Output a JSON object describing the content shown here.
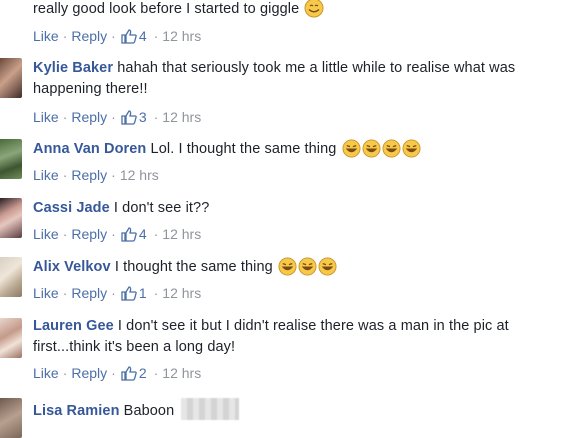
{
  "actions": {
    "like": "Like",
    "reply": "Reply",
    "separator": "·"
  },
  "comments": [
    {
      "name": "",
      "text": "really good look before I started to giggle",
      "emoji": "smile-emoji",
      "likes": "4",
      "time": "12 hrs"
    },
    {
      "name": "Kylie Baker",
      "text": "hahah that seriously took me a little while to realise what was happening there!!",
      "likes": "3",
      "time": "12 hrs"
    },
    {
      "name": "Anna Van Doren",
      "text": "Lol. I thought the same thing",
      "emoji": "laughing-emoji x4",
      "likes": "",
      "time": "12 hrs"
    },
    {
      "name": "Cassi Jade",
      "text": "I don't see it??",
      "likes": "4",
      "time": "12 hrs"
    },
    {
      "name": "Alix Velkov",
      "text": "I thought the same thing",
      "emoji": "laughing-emoji x3",
      "likes": "1",
      "time": "12 hrs"
    },
    {
      "name": "Lauren Gee",
      "text": "I don't see it but I didn't realise there was a man in the pic at first...think it's been a long day!",
      "likes": "2",
      "time": "12 hrs"
    },
    {
      "name": "Lisa Ramien",
      "text": "Baboon",
      "likes": "",
      "time": ""
    }
  ],
  "colors": {
    "name": "#365899",
    "action": "#4b6fa8",
    "meta": "#90949c",
    "text": "#1d2129"
  }
}
